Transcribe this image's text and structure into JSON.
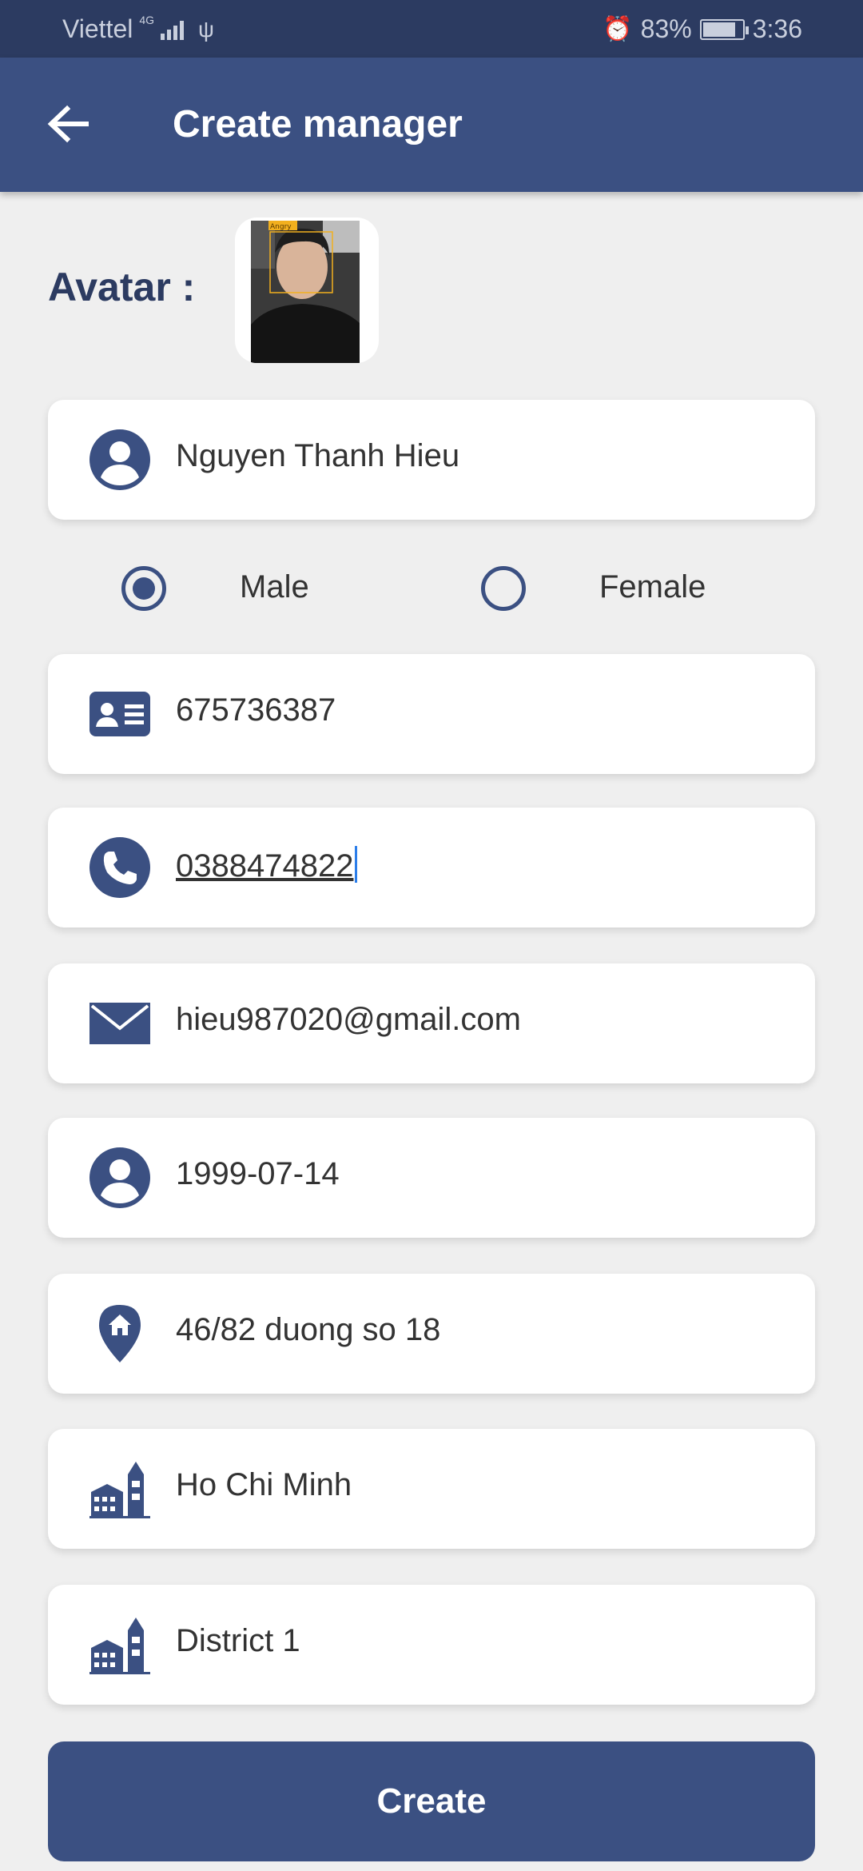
{
  "status_bar": {
    "carrier": "Viettel",
    "network": "4G",
    "battery": "83%",
    "battery_level": 0.83,
    "time": "3:36"
  },
  "app_bar": {
    "title": "Create manager",
    "back_icon": "arrow-left-icon"
  },
  "avatar": {
    "label": "Avatar :",
    "photo_tag": "Angry"
  },
  "form": {
    "name": "Nguyen Thanh Hieu",
    "gender_options": [
      "Male",
      "Female"
    ],
    "gender_selected": "Male",
    "id_number": "675736387",
    "phone": "0388474822",
    "email": "hieu987020@gmail.com",
    "birthday": "1999-07-14",
    "address": "46/82 duong so 18",
    "city": "Ho Chi Minh",
    "district": "District 1"
  },
  "actions": {
    "create_label": "Create"
  },
  "colors": {
    "primary": "#3b5082",
    "status_bar": "#2c3b61",
    "background": "#efefef",
    "caret": "#2b7de9"
  }
}
